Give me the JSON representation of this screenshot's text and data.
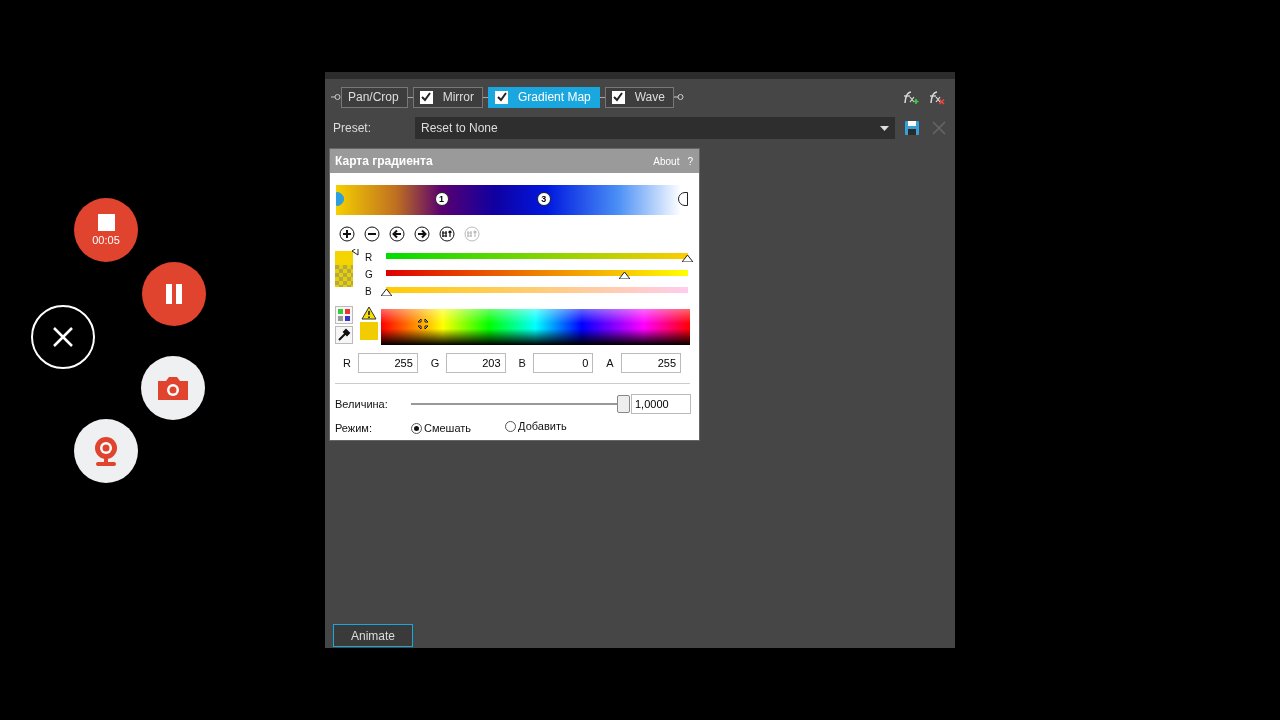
{
  "recorder": {
    "timer": "00:05"
  },
  "chain": [
    {
      "kind": "plain",
      "label": "Pan/Crop"
    },
    {
      "kind": "checkbox",
      "label": "Mirror",
      "checked": true,
      "selected": false
    },
    {
      "kind": "checkbox",
      "label": "Gradient Map",
      "checked": true,
      "selected": true
    },
    {
      "kind": "checkbox",
      "label": "Wave",
      "checked": true,
      "selected": false
    }
  ],
  "preset": {
    "label": "Preset:",
    "value": "Reset to None"
  },
  "dialog": {
    "title": "Карта градиента",
    "about": "About",
    "help": "?",
    "stops": [
      {
        "selected": true,
        "level": 0
      },
      {
        "label": "1",
        "selected": false,
        "level": 0.3
      },
      {
        "label": "3",
        "selected": false,
        "level": 0.59
      },
      {
        "selected": false,
        "level": 1
      }
    ],
    "channels": [
      {
        "label": "R",
        "level": 1
      },
      {
        "label": "G",
        "level": 0.79
      },
      {
        "label": "B",
        "level": 0
      }
    ],
    "fields": [
      {
        "label": "R",
        "value": "255"
      },
      {
        "label": "G",
        "value": "203"
      },
      {
        "label": "B",
        "value": "0"
      },
      {
        "label": "A",
        "value": "255"
      }
    ],
    "amount": {
      "label": "Величина:",
      "level": 1,
      "value": "1,0000"
    },
    "mode": {
      "label": "Режим:",
      "options": [
        {
          "label": "Смешать",
          "selected": true
        },
        {
          "label": "Добавить",
          "selected": false
        }
      ]
    }
  },
  "animate": "Animate"
}
